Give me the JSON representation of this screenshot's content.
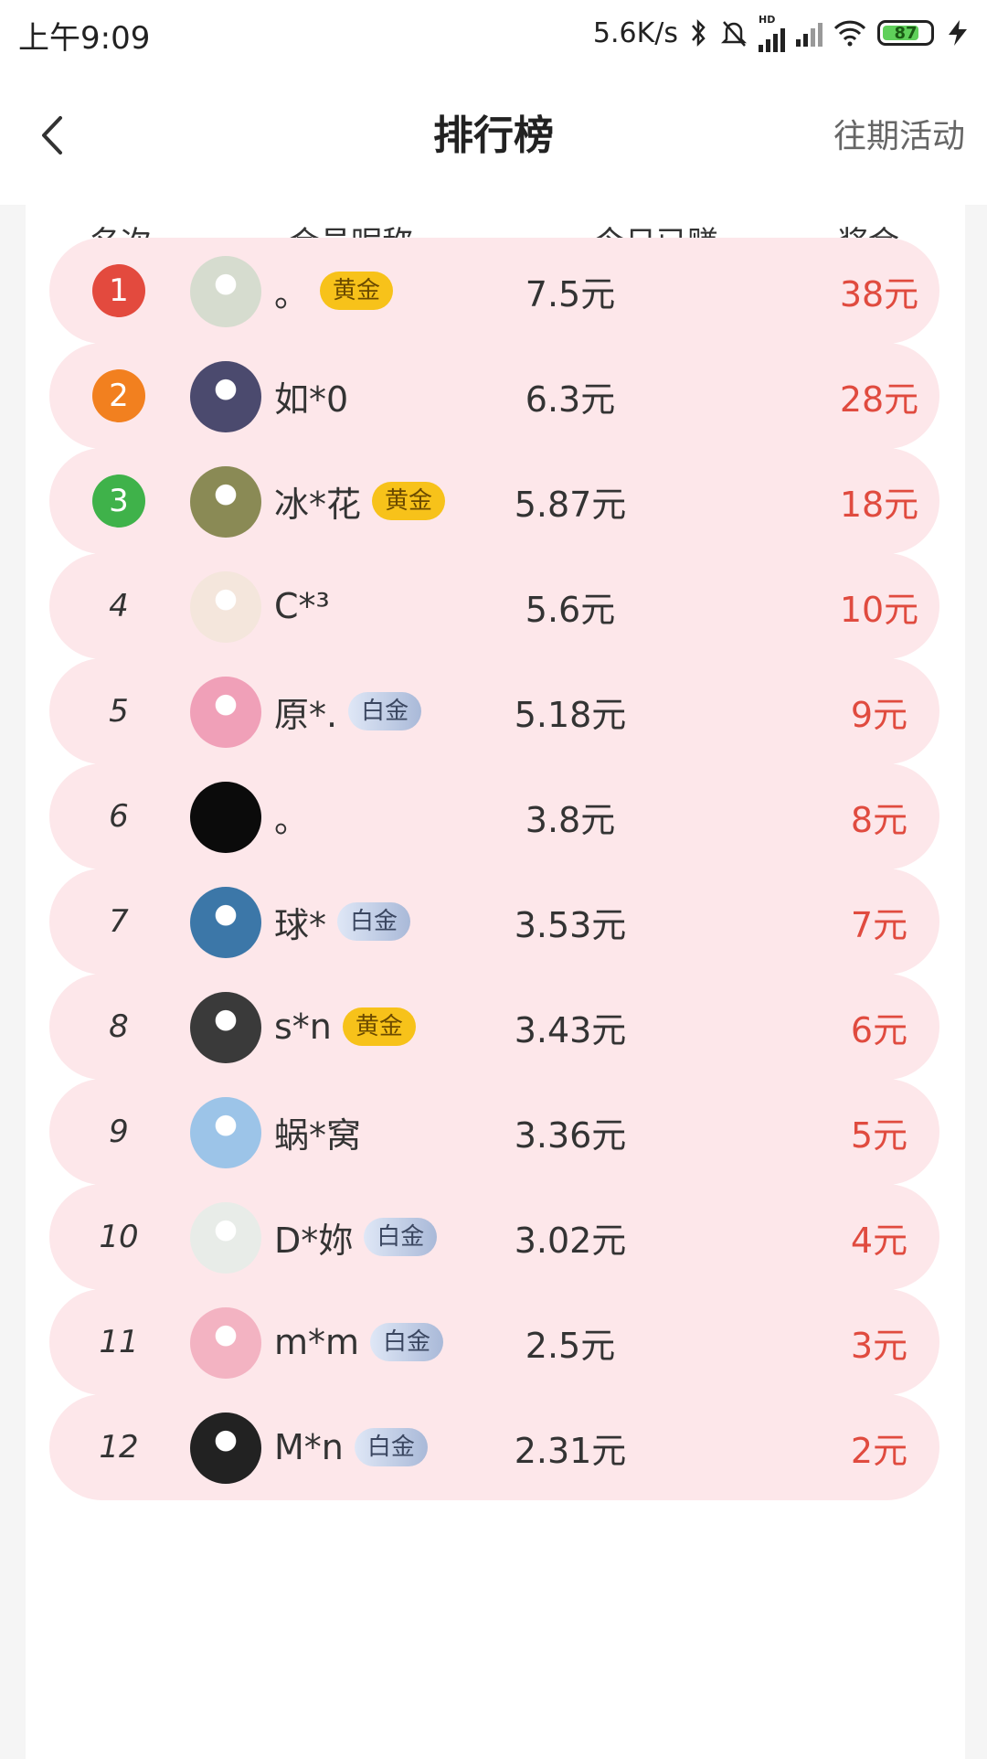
{
  "status_bar": {
    "time": "上午9:09",
    "net_speed": "5.6K/s",
    "battery": "87",
    "hd_label": "HD"
  },
  "header": {
    "back_icon": "chevron-left-icon",
    "title": "排行榜",
    "past_events": "往期活动"
  },
  "columns": {
    "rank": "名次",
    "nickname": "会员昵称",
    "earned_today": "今日已赚",
    "prize": "奖金"
  },
  "colors": {
    "row_bg": "#fde7ea",
    "prize_text": "#e04b3f",
    "rank1": "#e34a3e",
    "rank2": "#f2801f",
    "rank3": "#3fb24a",
    "gold_tag": "#f7c21a",
    "platinum_tag": "#b7c5e0"
  },
  "rows": [
    {
      "rank": "1",
      "nickname": "。",
      "tag": "黄金",
      "tag_type": "gold",
      "earned": "7.5元",
      "prize": "38元"
    },
    {
      "rank": "2",
      "nickname": "如*0",
      "tag": "",
      "tag_type": "",
      "earned": "6.3元",
      "prize": "28元"
    },
    {
      "rank": "3",
      "nickname": "冰*花",
      "tag": "黄金",
      "tag_type": "gold",
      "earned": "5.87元",
      "prize": "18元"
    },
    {
      "rank": "4",
      "nickname": "C*³",
      "tag": "",
      "tag_type": "",
      "earned": "5.6元",
      "prize": "10元"
    },
    {
      "rank": "5",
      "nickname": "原*.",
      "tag": "白金",
      "tag_type": "platinum",
      "earned": "5.18元",
      "prize": "9元"
    },
    {
      "rank": "6",
      "nickname": "。",
      "tag": "",
      "tag_type": "",
      "earned": "3.8元",
      "prize": "8元"
    },
    {
      "rank": "7",
      "nickname": "球*",
      "tag": "白金",
      "tag_type": "platinum",
      "earned": "3.53元",
      "prize": "7元"
    },
    {
      "rank": "8",
      "nickname": "s*n",
      "tag": "黄金",
      "tag_type": "gold",
      "earned": "3.43元",
      "prize": "6元"
    },
    {
      "rank": "9",
      "nickname": "蜗*窝",
      "tag": "",
      "tag_type": "",
      "earned": "3.36元",
      "prize": "5元"
    },
    {
      "rank": "10",
      "nickname": "D*妳",
      "tag": "白金",
      "tag_type": "platinum",
      "earned": "3.02元",
      "prize": "4元"
    },
    {
      "rank": "11",
      "nickname": "m*m",
      "tag": "白金",
      "tag_type": "platinum",
      "earned": "2.5元",
      "prize": "3元"
    },
    {
      "rank": "12",
      "nickname": "M*n",
      "tag": "白金",
      "tag_type": "platinum",
      "earned": "2.31元",
      "prize": "2元"
    }
  ]
}
